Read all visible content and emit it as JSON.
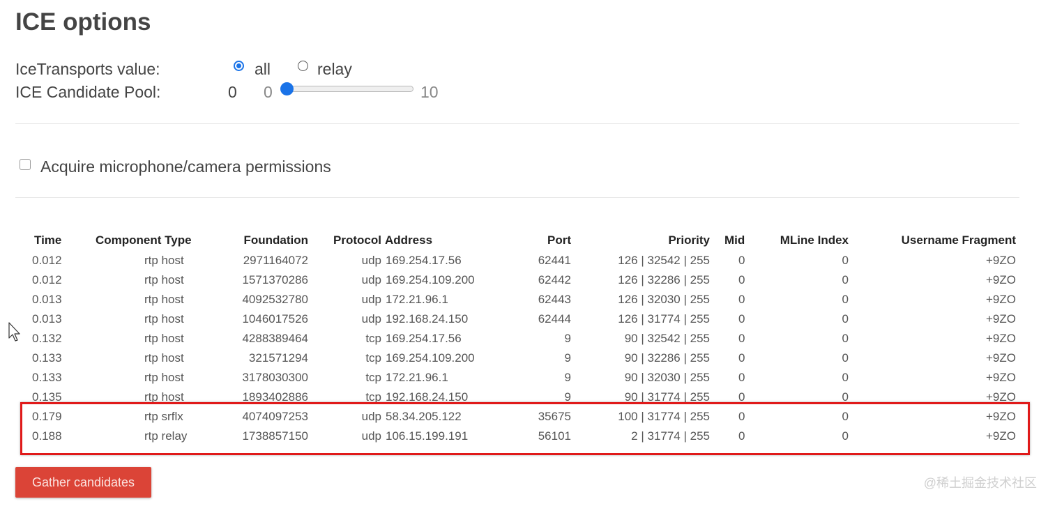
{
  "page_title": "ICE options",
  "ice_transports": {
    "label": "IceTransports value:",
    "options": [
      {
        "label": "all",
        "selected": true
      },
      {
        "label": "relay",
        "selected": false
      }
    ]
  },
  "candidate_pool": {
    "label": "ICE Candidate Pool:",
    "value": "0",
    "min": "0",
    "max": "10"
  },
  "permissions": {
    "label": "Acquire microphone/camera permissions",
    "checked": false
  },
  "table": {
    "headers": [
      "Time",
      "Component Type",
      "Foundation",
      "Protocol",
      "Address",
      "Port",
      "Priority",
      "Mid",
      "MLine Index",
      "Username Fragment"
    ],
    "rows": [
      {
        "time": "0.012",
        "component": "rtp",
        "type": "host",
        "foundation": "2971164072",
        "protocol": "udp",
        "address": "169.254.17.56",
        "port": "62441",
        "priority": "126 | 32542 | 255",
        "mid": "0",
        "mline": "0",
        "ufrag": "+9ZO"
      },
      {
        "time": "0.012",
        "component": "rtp",
        "type": "host",
        "foundation": "1571370286",
        "protocol": "udp",
        "address": "169.254.109.200",
        "port": "62442",
        "priority": "126 | 32286 | 255",
        "mid": "0",
        "mline": "0",
        "ufrag": "+9ZO"
      },
      {
        "time": "0.013",
        "component": "rtp",
        "type": "host",
        "foundation": "4092532780",
        "protocol": "udp",
        "address": "172.21.96.1",
        "port": "62443",
        "priority": "126 | 32030 | 255",
        "mid": "0",
        "mline": "0",
        "ufrag": "+9ZO"
      },
      {
        "time": "0.013",
        "component": "rtp",
        "type": "host",
        "foundation": "1046017526",
        "protocol": "udp",
        "address": "192.168.24.150",
        "port": "62444",
        "priority": "126 | 31774 | 255",
        "mid": "0",
        "mline": "0",
        "ufrag": "+9ZO"
      },
      {
        "time": "0.132",
        "component": "rtp",
        "type": "host",
        "foundation": "4288389464",
        "protocol": "tcp",
        "address": "169.254.17.56",
        "port": "9",
        "priority": "90 | 32542 | 255",
        "mid": "0",
        "mline": "0",
        "ufrag": "+9ZO"
      },
      {
        "time": "0.133",
        "component": "rtp",
        "type": "host",
        "foundation": "321571294",
        "protocol": "tcp",
        "address": "169.254.109.200",
        "port": "9",
        "priority": "90 | 32286 | 255",
        "mid": "0",
        "mline": "0",
        "ufrag": "+9ZO"
      },
      {
        "time": "0.133",
        "component": "rtp",
        "type": "host",
        "foundation": "3178030300",
        "protocol": "tcp",
        "address": "172.21.96.1",
        "port": "9",
        "priority": "90 | 32030 | 255",
        "mid": "0",
        "mline": "0",
        "ufrag": "+9ZO"
      },
      {
        "time": "0.135",
        "component": "rtp",
        "type": "host",
        "foundation": "1893402886",
        "protocol": "tcp",
        "address": "192.168.24.150",
        "port": "9",
        "priority": "90 | 31774 | 255",
        "mid": "0",
        "mline": "0",
        "ufrag": "+9ZO"
      },
      {
        "time": "0.179",
        "component": "rtp",
        "type": "srflx",
        "foundation": "4074097253",
        "protocol": "udp",
        "address": "58.34.205.122",
        "port": "35675",
        "priority": "100 | 31774 | 255",
        "mid": "0",
        "mline": "0",
        "ufrag": "+9ZO"
      },
      {
        "time": "0.188",
        "component": "rtp",
        "type": "relay",
        "foundation": "1738857150",
        "protocol": "udp",
        "address": "106.15.199.191",
        "port": "56101",
        "priority": "2 | 31774 | 255",
        "mid": "0",
        "mline": "0",
        "ufrag": "+9ZO"
      }
    ]
  },
  "gather_button": "Gather candidates",
  "watermark": "@稀土掘金技术社区",
  "colors": {
    "accent": "#1a73e8",
    "button": "#db4437",
    "highlight": "#e01a1a"
  }
}
